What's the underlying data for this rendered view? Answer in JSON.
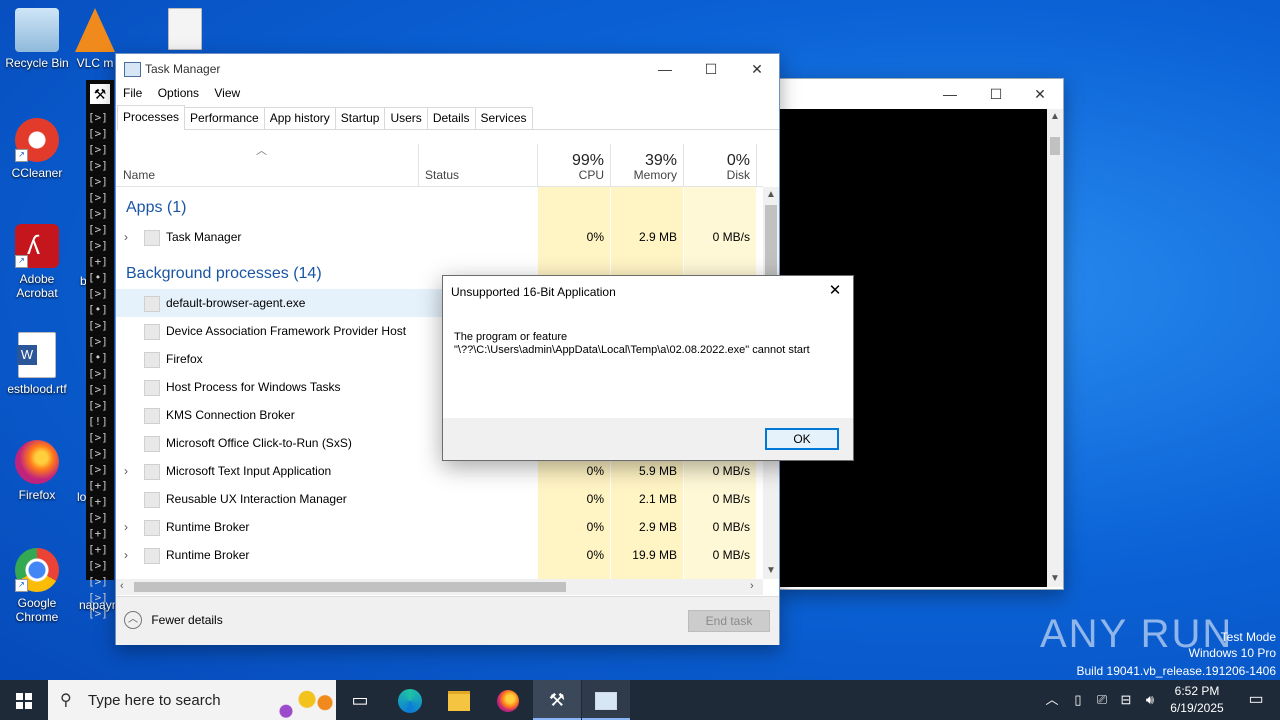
{
  "desktop": {
    "icons": [
      {
        "label": "Recycle Bin"
      },
      {
        "label": "VLC m"
      },
      {
        "label": "CCleaner"
      },
      {
        "label": "Adobe Acrobat"
      },
      {
        "label": "estblood.rtf"
      },
      {
        "label": "Firefox"
      },
      {
        "label": "Google Chrome"
      },
      {
        "label": "b"
      },
      {
        "label": "lo"
      },
      {
        "label": "napayn"
      }
    ],
    "watermark": {
      "brand": "ANY RUN",
      "line1": "Test Mode",
      "line2": "Windows 10 Pro",
      "line3": "Build 19041.vb_release.191206-1406"
    }
  },
  "console": {
    "lines": [
      "[>]",
      "[>]",
      "[>]",
      "[>]",
      "[>]",
      "[>]",
      "[>]",
      "[>]",
      "[>]",
      "[+]",
      "[•]",
      "[>]",
      "[•]",
      "[>]",
      "[>]",
      "[•]",
      "[>]",
      "[>]",
      "[>]",
      "[!]",
      "[>]",
      "[>]",
      "[>]",
      "[+]",
      "[+]",
      "[>]",
      "[+]",
      "[+]",
      "[>]",
      "[>]",
      "[>]",
      "[>]"
    ],
    "controls": {
      "min": "—",
      "max": "☐",
      "close": "✕"
    }
  },
  "taskmgr": {
    "title": "Task Manager",
    "menu": [
      "File",
      "Options",
      "View"
    ],
    "tabs": [
      "Processes",
      "Performance",
      "App history",
      "Startup",
      "Users",
      "Details",
      "Services"
    ],
    "columns": {
      "name": "Name",
      "status": "Status",
      "cpu": {
        "pct": "99%",
        "label": "CPU"
      },
      "memory": {
        "pct": "39%",
        "label": "Memory"
      },
      "disk": {
        "pct": "0%",
        "label": "Disk"
      }
    },
    "sections": {
      "apps": "Apps (1)",
      "background": "Background processes (14)"
    },
    "apps": [
      {
        "name": "Task Manager",
        "cpu": "0%",
        "mem": "2.9 MB",
        "disk": "0 MB/s"
      }
    ],
    "background": [
      {
        "name": "default-browser-agent.exe",
        "cpu": "",
        "mem": "",
        "disk": ""
      },
      {
        "name": "Device Association Framework Provider Host",
        "cpu": "",
        "mem": "",
        "disk": ""
      },
      {
        "name": "Firefox",
        "cpu": "",
        "mem": "",
        "disk": ""
      },
      {
        "name": "Host Process for Windows Tasks",
        "cpu": "",
        "mem": "",
        "disk": ""
      },
      {
        "name": "KMS Connection Broker",
        "cpu": "",
        "mem": "",
        "disk": ""
      },
      {
        "name": "Microsoft Office Click-to-Run (SxS)",
        "cpu": "",
        "mem": "",
        "disk": ""
      },
      {
        "name": "Microsoft Text Input Application",
        "cpu": "0%",
        "mem": "5.9 MB",
        "disk": "0 MB/s"
      },
      {
        "name": "Reusable UX Interaction Manager",
        "cpu": "0%",
        "mem": "2.1 MB",
        "disk": "0 MB/s"
      },
      {
        "name": "Runtime Broker",
        "cpu": "0%",
        "mem": "2.9 MB",
        "disk": "0 MB/s"
      },
      {
        "name": "Runtime Broker",
        "cpu": "0%",
        "mem": "19.9 MB",
        "disk": "0 MB/s"
      }
    ],
    "footer": {
      "fewer": "Fewer details",
      "endtask": "End task"
    }
  },
  "dialog": {
    "title": "Unsupported 16-Bit Application",
    "line1": "The program or feature",
    "line2": "\"\\??\\C:\\Users\\admin\\AppData\\Local\\Temp\\a\\02.08.2022.exe\" cannot start",
    "ok": "OK"
  },
  "taskbar": {
    "search_placeholder": "Type here to search",
    "time": "6:52 PM",
    "date": "6/19/2025"
  }
}
